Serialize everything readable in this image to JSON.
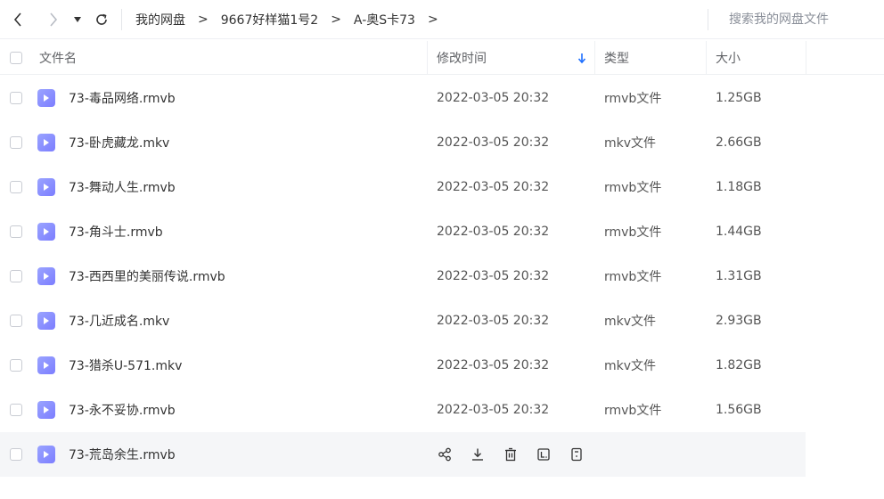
{
  "nav": {
    "breadcrumb": [
      "我的网盘",
      "9667好样猫1号2",
      "A-奥S卡73"
    ],
    "separator": ">",
    "search_placeholder": "搜索我的网盘文件"
  },
  "columns": {
    "name": "文件名",
    "modified": "修改时间",
    "type": "类型",
    "size": "大小"
  },
  "files": [
    {
      "name": "73-毒品网络.rmvb",
      "modified": "2022-03-05 20:32",
      "type": "rmvb文件",
      "size": "1.25GB"
    },
    {
      "name": "73-卧虎藏龙.mkv",
      "modified": "2022-03-05 20:32",
      "type": "mkv文件",
      "size": "2.66GB"
    },
    {
      "name": "73-舞动人生.rmvb",
      "modified": "2022-03-05 20:32",
      "type": "rmvb文件",
      "size": "1.18GB"
    },
    {
      "name": "73-角斗士.rmvb",
      "modified": "2022-03-05 20:32",
      "type": "rmvb文件",
      "size": "1.44GB"
    },
    {
      "name": "73-西西里的美丽传说.rmvb",
      "modified": "2022-03-05 20:32",
      "type": "rmvb文件",
      "size": "1.31GB"
    },
    {
      "name": "73-几近成名.mkv",
      "modified": "2022-03-05 20:32",
      "type": "mkv文件",
      "size": "2.93GB"
    },
    {
      "name": "73-猎杀U-571.mkv",
      "modified": "2022-03-05 20:32",
      "type": "mkv文件",
      "size": "1.82GB"
    },
    {
      "name": "73-永不妥协.rmvb",
      "modified": "2022-03-05 20:32",
      "type": "rmvb文件",
      "size": "1.56GB"
    },
    {
      "name": "73-荒岛余生.rmvb"
    }
  ],
  "hover_row_actions": [
    "share-icon",
    "download-icon",
    "delete-icon",
    "rename-icon",
    "more-icon"
  ],
  "colors": {
    "accent": "#1e6fff",
    "file_icon": "#8a8dff",
    "hover_row": "#f5f6f8"
  }
}
